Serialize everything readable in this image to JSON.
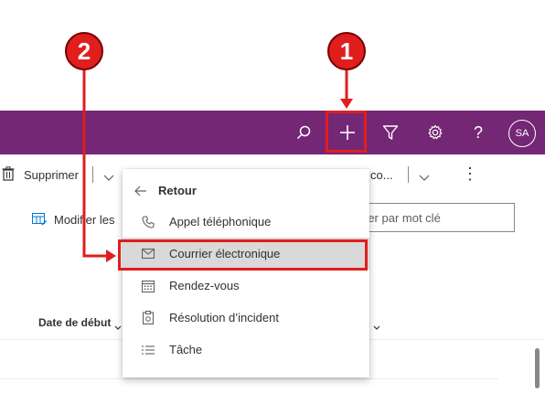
{
  "topbar": {
    "avatar_initials": "SA",
    "icons": [
      "search-icon",
      "add-icon",
      "filter-icon",
      "gear-icon",
      "help-icon"
    ]
  },
  "commandbar": {
    "delete_label": "Supprimer",
    "truncated_label": "co...",
    "edit_columns_label": "Modifier les"
  },
  "search": {
    "placeholder_visible": "rer par mot clé"
  },
  "column_header": {
    "start_date_label": "Date de début"
  },
  "menu": {
    "back_label": "Retour",
    "items": [
      {
        "label": "Appel téléphonique",
        "icon": "phone-icon"
      },
      {
        "label": "Courrier électronique",
        "icon": "mail-icon"
      },
      {
        "label": "Rendez-vous",
        "icon": "calendar-icon"
      },
      {
        "label": "Résolution d’incident",
        "icon": "case-resolution-icon"
      },
      {
        "label": "Tâche",
        "icon": "task-list-icon"
      }
    ]
  },
  "callouts": {
    "one": "1",
    "two": "2"
  },
  "colors": {
    "topbar": "#742774",
    "callout_red": "#e01e1e",
    "highlight_bg": "#d9d9d9"
  }
}
